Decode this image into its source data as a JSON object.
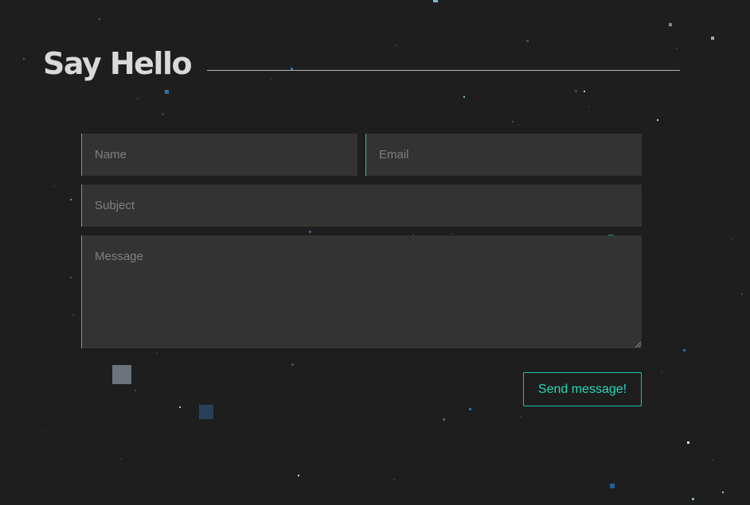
{
  "page": {
    "heading": "Say Hello"
  },
  "form": {
    "name_placeholder": "Name",
    "email_placeholder": "Email",
    "subject_placeholder": "Subject",
    "message_placeholder": "Message",
    "submit_label": "Send message!"
  },
  "colors": {
    "background": "#1e1e1e",
    "accent": "#19c6a8",
    "field_background": "#333333",
    "heading_text": "#d9d9d9"
  }
}
